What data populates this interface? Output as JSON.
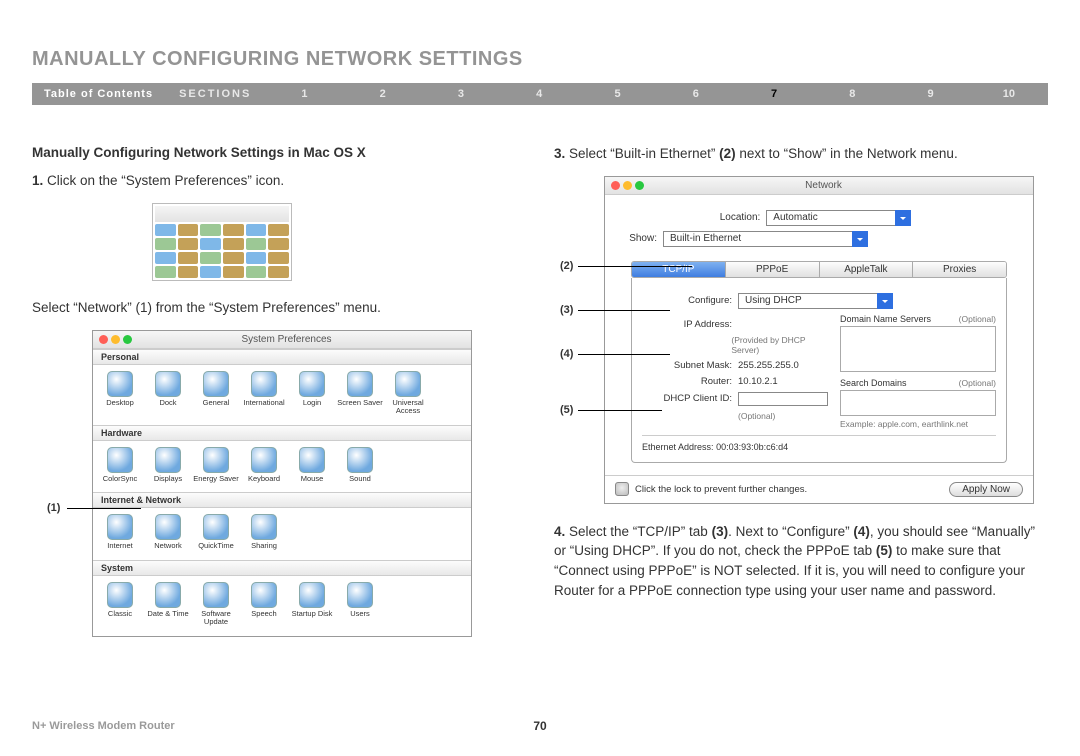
{
  "pageTitle": "MANUALLY CONFIGURING NETWORK SETTINGS",
  "nav": {
    "toc": "Table of Contents",
    "sectionsLabel": "SECTIONS",
    "numbers": [
      "1",
      "2",
      "3",
      "4",
      "5",
      "6",
      "7",
      "8",
      "9",
      "10"
    ],
    "activeIndex": 6
  },
  "subheading": "Manually Configuring Network Settings in Mac OS X",
  "left": {
    "step1_num": "1.",
    "step1_text": " Click on the “System Preferences” icon.",
    "step1b": "Select “Network” (1) from the “System Preferences” menu.",
    "sysprefTitle": "System Preferences",
    "groups": {
      "personal": "Personal",
      "hardware": "Hardware",
      "internet": "Internet & Network",
      "system": "System"
    },
    "icons": {
      "personal": [
        "Desktop",
        "Dock",
        "General",
        "International",
        "Login",
        "Screen Saver",
        "Universal Access"
      ],
      "hardware": [
        "ColorSync",
        "Displays",
        "Energy Saver",
        "Keyboard",
        "Mouse",
        "Sound"
      ],
      "internet": [
        "Internet",
        "Network",
        "QuickTime",
        "Sharing"
      ],
      "system": [
        "Classic",
        "Date & Time",
        "Software Update",
        "Speech",
        "Startup Disk",
        "Users"
      ]
    },
    "callout1": "(1)"
  },
  "right": {
    "step3_num": "3.",
    "step3_a": " Select “Built-in Ethernet” ",
    "step3_b": "(2)",
    "step3_c": " next to “Show” in the Network menu.",
    "netTitle": "Network",
    "locationLabel": "Location:",
    "locationValue": "Automatic",
    "showLabel": "Show:",
    "showValue": "Built-in Ethernet",
    "tabs": [
      "TCP/IP",
      "PPPoE",
      "AppleTalk",
      "Proxies"
    ],
    "configureLabel": "Configure:",
    "configureValue": "Using DHCP",
    "ipLabel": "IP Address:",
    "ipHint": "(Provided by DHCP Server)",
    "subnetLabel": "Subnet Mask:",
    "subnetValue": "255.255.255.0",
    "routerLabel": "Router:",
    "routerValue": "10.10.2.1",
    "dhcpLabel": "DHCP Client ID:",
    "dhcpHint": "(Optional)",
    "dnsLabel": "Domain Name Servers",
    "dnsOpt": "(Optional)",
    "searchLabel": "Search Domains",
    "searchOpt": "(Optional)",
    "exampleHint": "Example: apple.com, earthlink.net",
    "ethLabel": "Ethernet Address:",
    "ethValue": "00:03:93:0b:c6:d4",
    "lockText": "Click the lock to prevent further changes.",
    "applyLabel": "Apply Now",
    "callouts": {
      "c2": "(2)",
      "c3": "(3)",
      "c4": "(4)",
      "c5": "(5)"
    },
    "step4_num": "4.",
    "step4_a": " Select the “TCP/IP” tab ",
    "step4_b": "(3)",
    "step4_c": ". Next to “Configure” ",
    "step4_d": "(4)",
    "step4_e": ", you should see “Manually” or “Using DHCP”. If you do not, check the PPPoE tab ",
    "step4_f": "(5)",
    "step4_g": " to make sure that “Connect using PPPoE” is NOT selected. If it is, you will need to configure your Router for a PPPoE connection type using your user name and password."
  },
  "footer": {
    "product": "N+ Wireless Modem Router",
    "page": "70"
  }
}
